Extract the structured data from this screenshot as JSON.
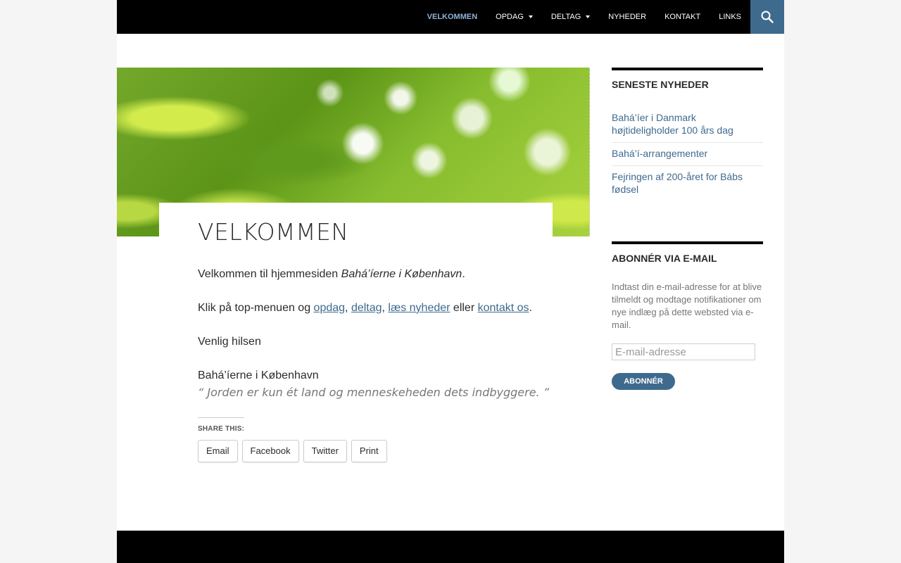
{
  "nav": {
    "items": [
      {
        "label": "VELKOMMEN",
        "active": true,
        "has_submenu": false
      },
      {
        "label": "OPDAG",
        "active": false,
        "has_submenu": true
      },
      {
        "label": "DELTAG",
        "active": false,
        "has_submenu": true
      },
      {
        "label": "NYHEDER",
        "active": false,
        "has_submenu": false
      },
      {
        "label": "KONTAKT",
        "active": false,
        "has_submenu": false
      },
      {
        "label": "LINKS",
        "active": false,
        "has_submenu": false
      }
    ],
    "search_icon": "search-icon"
  },
  "entry": {
    "title": "VELKOMMEN",
    "p1_text": "Velkommen til hjemmesiden ",
    "p1_emph": "Bahá’íerne i København",
    "p1_end": ".",
    "p2_start": "Klik på top-menuen og ",
    "link_opdag": "opdag",
    "comma1": ", ",
    "link_deltag": "deltag",
    "comma2": ", ",
    "link_nyheder": "læs nyheder",
    "p2_mid": " eller ",
    "link_kontakt": "kontakt os",
    "p2_end": ".",
    "p3": "Venlig hilsen",
    "p4": "Bahá’íerne i København",
    "quote": "“ Jorden er kun ét land og menneskeheden dets indbyggere. ”",
    "share_label": "SHARE THIS:",
    "share_buttons": [
      "Email",
      "Facebook",
      "Twitter",
      "Print"
    ]
  },
  "sidebar": {
    "news_title": "SENESTE NYHEDER",
    "news_items": [
      "Bahá’íer i Danmark højtideligholder 100 års dag",
      "Bahá’í-arrangementer",
      "Fejringen af 200-året for Bábs fødsel"
    ],
    "subscribe_title": "ABONNÉR VIA E-MAIL",
    "subscribe_desc": "Indtast din e-mail-adresse for at blive tilmeldt og modtage notifikationer om nye indlæg på dette websted via e-mail.",
    "email_placeholder": "E-mail-adresse",
    "email_value": "",
    "subscribe_button": "ABONNÉR"
  },
  "colors": {
    "link": "#3e6a8e",
    "header_bg": "#000000",
    "nav_active": "#8fb2d6",
    "search_bg": "#3e6a8e"
  }
}
